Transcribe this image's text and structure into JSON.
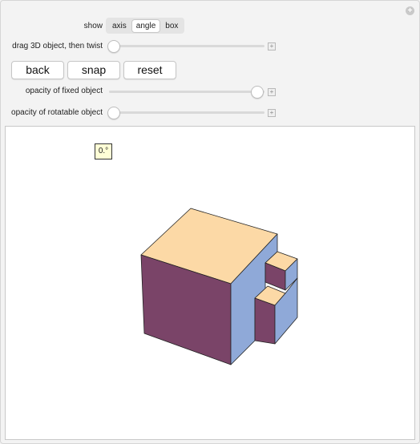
{
  "controls": {
    "show_label": "show",
    "show_options": [
      "axis",
      "angle",
      "box"
    ],
    "show_selected": "angle",
    "twist_label": "drag 3D object, then twist",
    "twist_value": 0,
    "buttons": {
      "back": "back",
      "snap": "snap",
      "reset": "reset"
    },
    "fixed_opacity_label": "opacity of fixed object",
    "fixed_opacity_value": 1,
    "rotatable_opacity_label": "opacity of rotatable object",
    "rotatable_opacity_value": 0
  },
  "view": {
    "angle_readout": "0.°"
  },
  "colors": {
    "top_face": "#fcd9a6",
    "front_face": "#7a4468",
    "side_face": "#8fa9d8",
    "accent_plus": "#888888"
  },
  "icons": {
    "corner": "plus-circle-icon",
    "slider_expand": "plus-square-icon"
  }
}
